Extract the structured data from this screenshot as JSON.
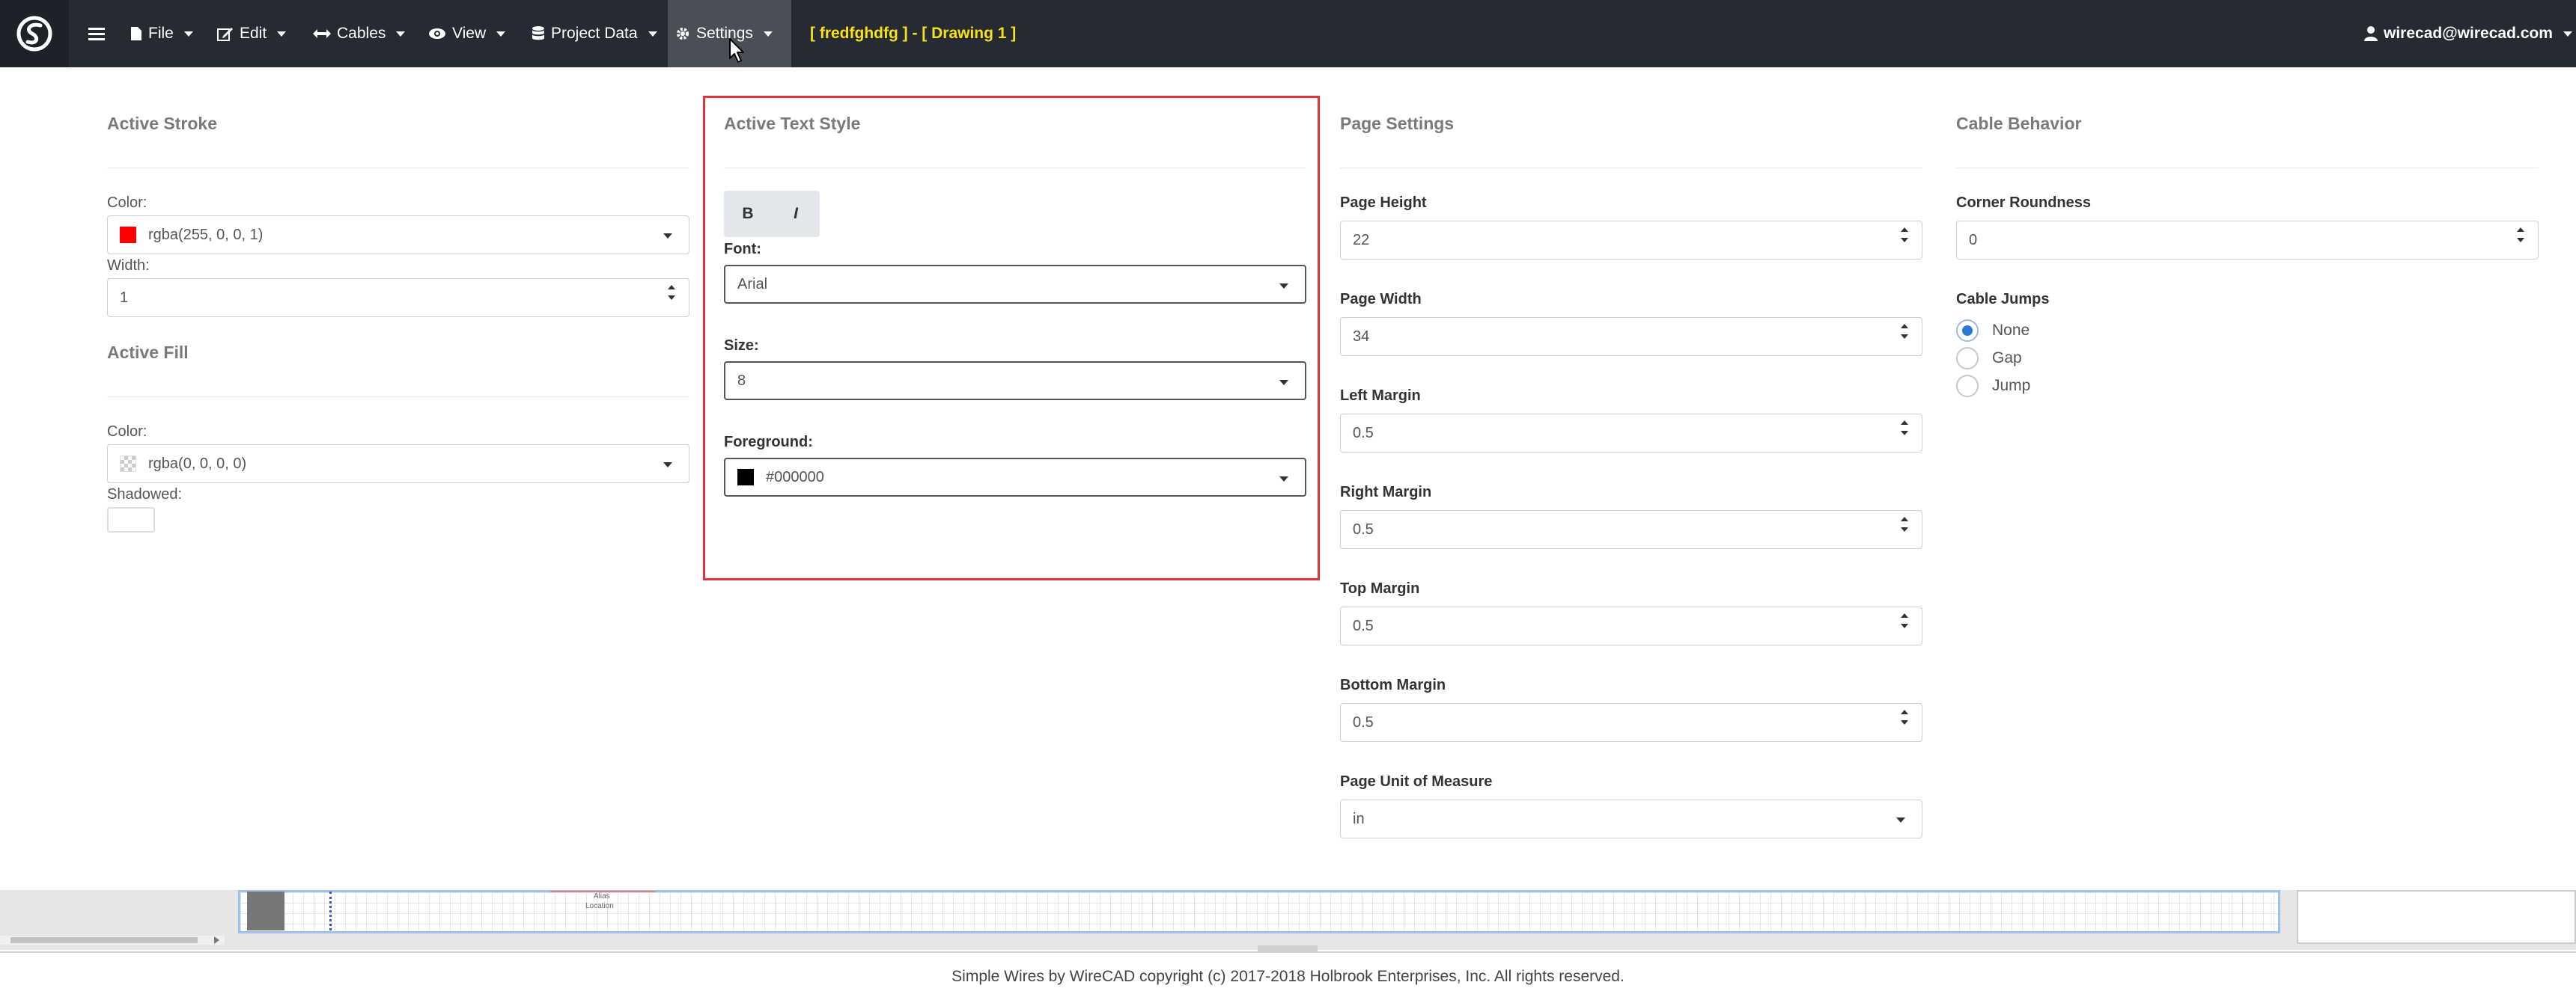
{
  "navbar": {
    "menu_items": [
      {
        "name": "file",
        "icon": "file-icon",
        "label": "File"
      },
      {
        "name": "edit",
        "icon": "edit-icon",
        "label": "Edit"
      },
      {
        "name": "cables",
        "icon": "arrows-horizontal-icon",
        "label": "Cables"
      },
      {
        "name": "view",
        "icon": "eye-icon",
        "label": "View"
      },
      {
        "name": "project-data",
        "icon": "database-icon",
        "label": "Project Data"
      },
      {
        "name": "settings",
        "icon": "gear-icon",
        "label": "Settings"
      }
    ],
    "document_title": "[ fredfghdfg ] - [ Drawing 1 ]",
    "user": "wirecad@wirecad.com",
    "colors": {
      "background": "#262a33",
      "title": "#f5e21b"
    }
  },
  "active_stroke": {
    "title": "Active Stroke",
    "color_label": "Color:",
    "color_value": "rgba(255, 0, 0, 1)",
    "swatch": "#ff0000",
    "width_label": "Width:",
    "width_value": "1"
  },
  "active_fill": {
    "title": "Active Fill",
    "color_label": "Color:",
    "color_value": "rgba(0, 0, 0, 0)",
    "shadowed_label": "Shadowed:"
  },
  "active_text_style": {
    "title": "Active Text Style",
    "bold_label": "B",
    "italic_label": "I",
    "font_label": "Font:",
    "font_value": "Arial",
    "size_label": "Size:",
    "size_value": "8",
    "foreground_label": "Foreground:",
    "foreground_value": "#000000",
    "highlight_color": "#e0343b"
  },
  "page_settings": {
    "title": "Page Settings",
    "fields": [
      {
        "label": "Page Height",
        "value": "22"
      },
      {
        "label": "Page Width",
        "value": "34"
      },
      {
        "label": "Left Margin",
        "value": "0.5"
      },
      {
        "label": "Right Margin",
        "value": "0.5"
      },
      {
        "label": "Top Margin",
        "value": "0.5"
      },
      {
        "label": "Bottom Margin",
        "value": "0.5"
      }
    ],
    "unit_label": "Page Unit of Measure",
    "unit_value": "in"
  },
  "cable_behavior": {
    "title": "Cable Behavior",
    "corner_label": "Corner Roundness",
    "corner_value": "0",
    "jumps_label": "Cable Jumps",
    "jump_options": [
      {
        "label": "None",
        "selected": true
      },
      {
        "label": "Gap",
        "selected": false
      },
      {
        "label": "Jump",
        "selected": false
      }
    ]
  },
  "canvas": {
    "alias_text": "Alias",
    "location_text": "Location"
  },
  "footer": {
    "text": "Simple Wires by WireCAD copyright (c) 2017-2018 Holbrook Enterprises, Inc. All rights reserved."
  }
}
